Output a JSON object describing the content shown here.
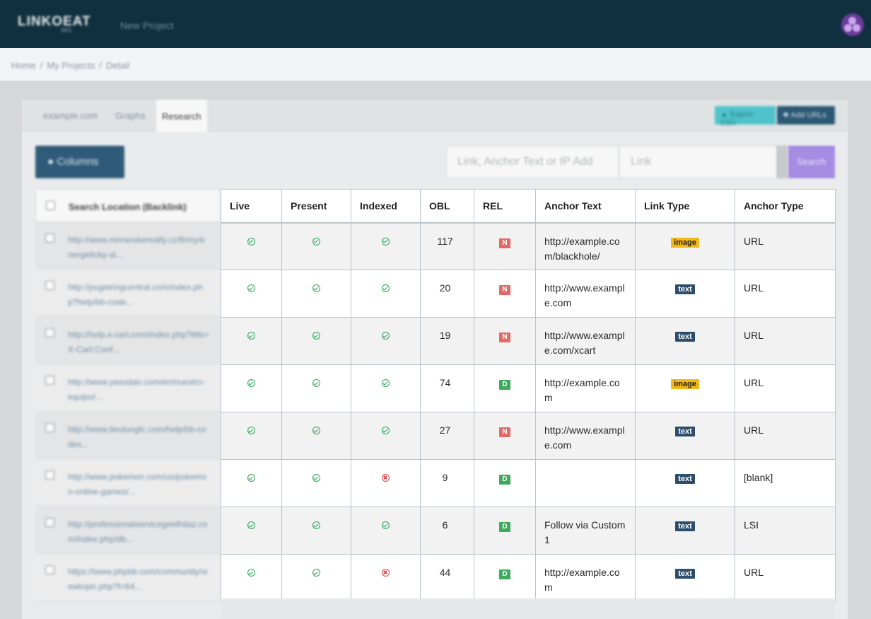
{
  "app": {
    "logo": "LINKOEAT",
    "logo_sub": "SEO",
    "new_project": "New Project"
  },
  "breadcrumb": [
    "Home",
    "My Projects",
    "Detail"
  ],
  "tabs": [
    {
      "label": "example.com"
    },
    {
      "label": "Graphs"
    },
    {
      "label": "Research",
      "active": true
    }
  ],
  "toolbar": {
    "export_label": "Export CSV",
    "add_urls_label": "Add URLs"
  },
  "controls": {
    "columns_label": "Columns",
    "search_placeholder": "Link, Anchor Text or IP Add",
    "search_select_value": "Link",
    "search_button": "Search"
  },
  "table": {
    "location_header": "Search Location (Backlink)",
    "columns": [
      "Live",
      "Present",
      "Indexed",
      "OBL",
      "REL",
      "Anchor Text",
      "Link Type",
      "Anchor Type"
    ],
    "rows": [
      {
        "location": "http://www.moravskerealty.cz/firmy/energeticky-st...",
        "live": true,
        "present": true,
        "indexed": true,
        "obl": "117",
        "rel": "N",
        "anchor_text": "http://example.com/blackhole/",
        "link_type": "image",
        "anchor_type": "URL"
      },
      {
        "location": "http://pugetringcentral.com/index.php?help/bb-code...",
        "live": true,
        "present": true,
        "indexed": true,
        "obl": "20",
        "rel": "N",
        "anchor_text": "http://www.example.com",
        "link_type": "text",
        "anchor_type": "URL"
      },
      {
        "location": "http://help.x-cart.com/index.php?title=X-Cart:Conf...",
        "live": true,
        "present": true,
        "indexed": true,
        "obl": "19",
        "rel": "N",
        "anchor_text": "http://www.example.com/xcart",
        "link_type": "text",
        "anchor_type": "URL"
      },
      {
        "location": "http://www.yasodan.com/en/nuestro-equipo/...",
        "live": true,
        "present": true,
        "indexed": true,
        "obl": "74",
        "rel": "D",
        "anchor_text": "http://example.com",
        "link_type": "image",
        "anchor_type": "URL"
      },
      {
        "location": "http://www.tieulongfc.com/help/bb-codes...",
        "live": true,
        "present": true,
        "indexed": true,
        "obl": "27",
        "rel": "N",
        "anchor_text": "http://www.example.com",
        "link_type": "text",
        "anchor_type": "URL"
      },
      {
        "location": "http://www.pokemon.com/us/pokemon-online-games/...",
        "live": true,
        "present": true,
        "indexed": false,
        "obl": "9",
        "rel": "D",
        "anchor_text": "",
        "link_type": "text",
        "anchor_type": "[blank]"
      },
      {
        "location": "http://professionalservicegeelhdaz.com/index.php/db...",
        "live": true,
        "present": true,
        "indexed": true,
        "obl": "6",
        "rel": "D",
        "anchor_text": "Follow via Custom 1",
        "link_type": "text",
        "anchor_type": "LSI"
      },
      {
        "location": "https://www.phpbb.com/community/viewtopic.php?f=64...",
        "live": true,
        "present": true,
        "indexed": false,
        "obl": "44",
        "rel": "D",
        "anchor_text": "http://example.com",
        "link_type": "text",
        "anchor_type": "URL"
      }
    ]
  },
  "colors": {
    "topbar": "#11303f",
    "accent_teal": "#4fc3cc",
    "accent_navy": "#2a5773",
    "search_purple": "#a68ce2",
    "rel_nofollow": "#e06b67",
    "rel_dofollow": "#3faa5d",
    "tag_image": "#f2b718",
    "tag_text": "#2c4d6c"
  }
}
